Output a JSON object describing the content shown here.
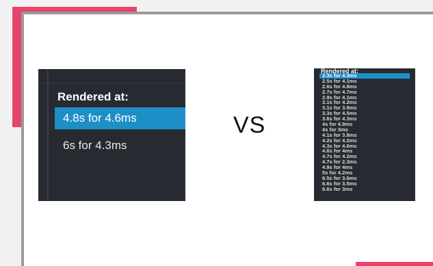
{
  "left_panel": {
    "title": "Rendered at:",
    "items": [
      {
        "label": "4.8s for 4.6ms",
        "selected": true
      },
      {
        "label": "6s for 4.3ms",
        "selected": false
      }
    ]
  },
  "separator_text": "VS",
  "right_panel": {
    "title": "Rendered at:",
    "items": [
      {
        "label": "2.3s for 4.3ms",
        "selected": true
      },
      {
        "label": "2.5s for 4.1ms",
        "selected": false
      },
      {
        "label": "2.6s for 4.8ms",
        "selected": false
      },
      {
        "label": "2.7s for 4.7ms",
        "selected": false
      },
      {
        "label": "2.9s for 4.1ms",
        "selected": false
      },
      {
        "label": "3.1s for 4.2ms",
        "selected": false
      },
      {
        "label": "3.1s for 3.9ms",
        "selected": false
      },
      {
        "label": "3.3s for 4.5ms",
        "selected": false
      },
      {
        "label": "3.6s for 4.3ms",
        "selected": false
      },
      {
        "label": "4s for 4.9ms",
        "selected": false
      },
      {
        "label": "4s for 3ms",
        "selected": false
      },
      {
        "label": "4.1s for 3.8ms",
        "selected": false
      },
      {
        "label": "4.2s for 4.2ms",
        "selected": false
      },
      {
        "label": "4.3s for 4.6ms",
        "selected": false
      },
      {
        "label": "4.6s for 4ms",
        "selected": false
      },
      {
        "label": "4.7s for 4.2ms",
        "selected": false
      },
      {
        "label": "4.7s for 2.3ms",
        "selected": false
      },
      {
        "label": "4.9s for 4ms",
        "selected": false
      },
      {
        "label": "5s for 4.2ms",
        "selected": false
      },
      {
        "label": "6.5s for 3.6ms",
        "selected": false
      },
      {
        "label": "6.6s for 3.5ms",
        "selected": false
      },
      {
        "label": "6.6s for 3ms",
        "selected": false
      }
    ]
  },
  "colors": {
    "accent": "#e8436a",
    "panel_bg": "#272b31",
    "selection": "#1d8fc6"
  }
}
